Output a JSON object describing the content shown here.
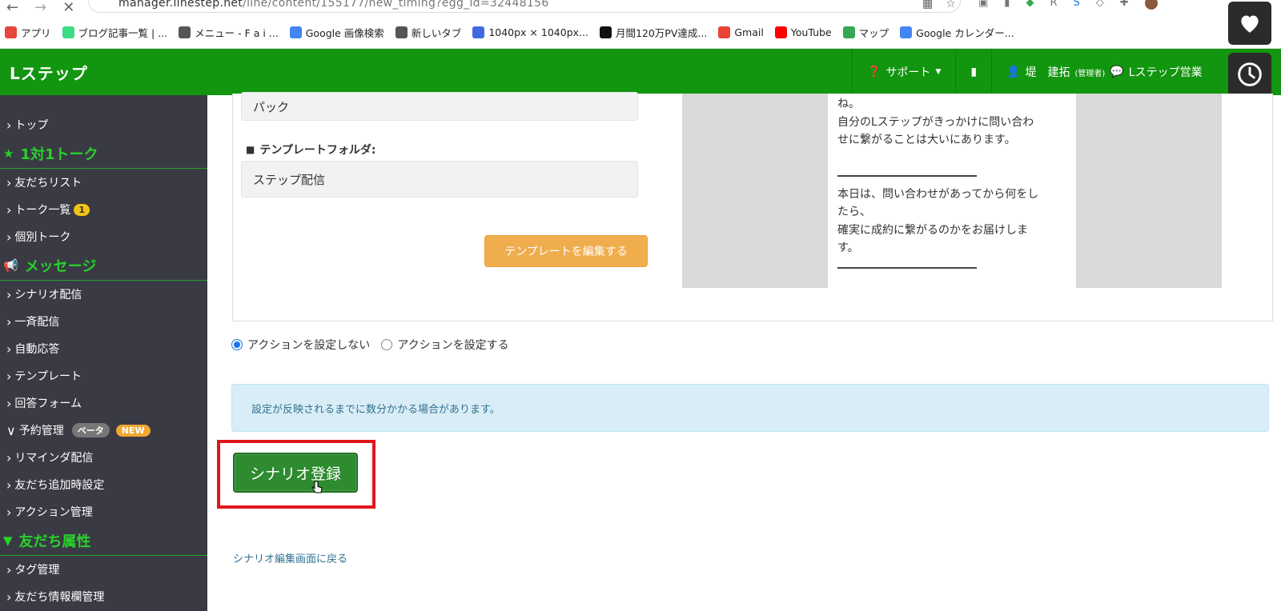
{
  "browser": {
    "url_host": "manager.linestep.net",
    "url_path": "/line/content/155177/new_timing?egg_id=32448156",
    "bookmarks": [
      {
        "label": "アプリ",
        "icon": "apps-grid-icon",
        "color": "#e8453c"
      },
      {
        "label": "ブログ記事一覧 | ...",
        "icon": "android-icon",
        "color": "#3ddc84"
      },
      {
        "label": "メニュー - F a i ...",
        "icon": "globe-icon",
        "color": "#555555"
      },
      {
        "label": "Google 画像検索",
        "icon": "google-icon",
        "color": "#4285f4"
      },
      {
        "label": "新しいタブ",
        "icon": "globe-icon",
        "color": "#555555"
      },
      {
        "label": "1040px × 1040px...",
        "icon": "c-icon",
        "color": "#4169e1"
      },
      {
        "label": "月間120万PV達成...",
        "icon": "w-icon",
        "color": "#111111"
      },
      {
        "label": "Gmail",
        "icon": "gmail-icon",
        "color": "#ea4335"
      },
      {
        "label": "YouTube",
        "icon": "youtube-icon",
        "color": "#ff0000"
      },
      {
        "label": "マップ",
        "icon": "maps-pin-icon",
        "color": "#34a853"
      },
      {
        "label": "Google カレンダー...",
        "icon": "calendar-icon",
        "color": "#4285f4"
      }
    ]
  },
  "header": {
    "brand": "Lステップ",
    "support_label": "サポート",
    "user_name": "堤　建拓",
    "user_role": "(管理者)",
    "account_label": "Lステップ営業"
  },
  "sidebar": {
    "items": [
      {
        "type": "item",
        "label": "トップ"
      },
      {
        "type": "head",
        "label": "1対1トーク",
        "icon": "star-icon"
      },
      {
        "type": "item",
        "label": "友だちリスト"
      },
      {
        "type": "item",
        "label": "トーク一覧",
        "badge": "1"
      },
      {
        "type": "item",
        "label": "個別トーク"
      },
      {
        "type": "head",
        "label": "メッセージ",
        "icon": "megaphone-icon"
      },
      {
        "type": "item",
        "label": "シナリオ配信"
      },
      {
        "type": "item",
        "label": "一斉配信"
      },
      {
        "type": "item",
        "label": "自動応答"
      },
      {
        "type": "item",
        "label": "テンプレート"
      },
      {
        "type": "item",
        "label": "回答フォーム"
      },
      {
        "type": "item",
        "label": "予約管理",
        "expanded": true,
        "beta": "ベータ",
        "new": "NEW"
      },
      {
        "type": "item",
        "label": "リマインダ配信"
      },
      {
        "type": "item",
        "label": "友だち追加時設定"
      },
      {
        "type": "item",
        "label": "アクション管理"
      },
      {
        "type": "head",
        "label": "友だち属性",
        "icon": "filter-icon"
      },
      {
        "type": "item",
        "label": "タグ管理"
      },
      {
        "type": "item",
        "label": "友だち情報欄管理"
      }
    ]
  },
  "form": {
    "pack_value": "パック",
    "folder_label": "テンプレートフォルダ:",
    "folder_value": "ステップ配信",
    "edit_template_label": "テンプレートを編集する"
  },
  "preview": {
    "line1": "ね。",
    "line2": "自分のLステップがきっかけに問い合わ",
    "line3": "せに繋がることは大いにあります。",
    "line4": "本日は、問い合わせがあってから何をし",
    "line5": "たら、",
    "line6": "確実に成約に繋がるのかをお届けしま",
    "line7": "す。"
  },
  "actions": {
    "option_off": "アクションを設定しない",
    "option_on": "アクションを設定する",
    "selected": "off"
  },
  "notice": "設定が反映されるまでに数分かかる場合があります。",
  "submit_label": "シナリオ登録",
  "back_link": "シナリオ編集画面に戻る",
  "colors": {
    "brand_green": "#12950f",
    "sidebar_bg": "#3a3a45",
    "highlight_red": "#e0161b",
    "warning_orange": "#f0ad4e"
  }
}
